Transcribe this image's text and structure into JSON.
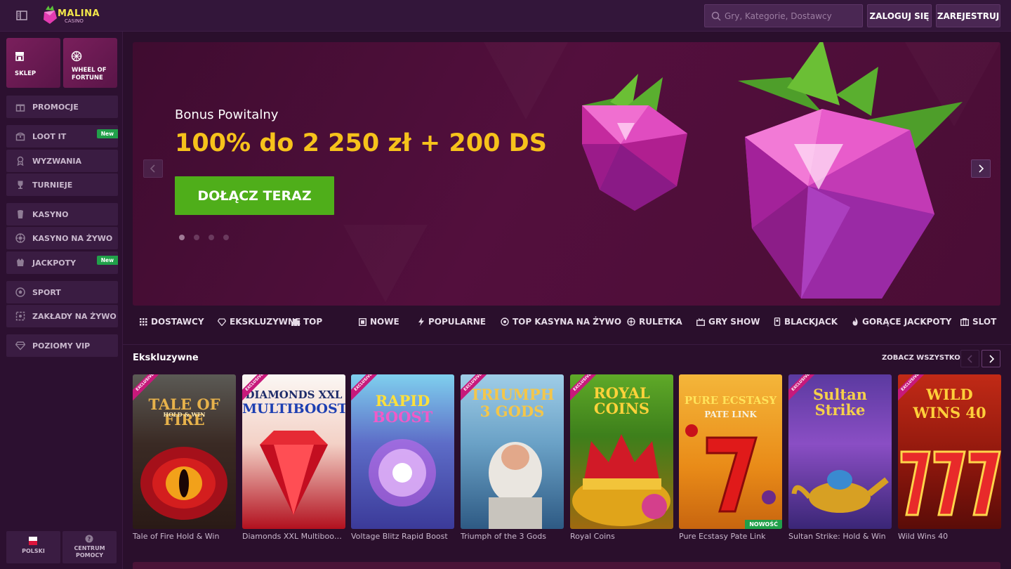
{
  "brand": {
    "name": "MALINA",
    "sub": "CASINO"
  },
  "header": {
    "search_placeholder": "Gry, Kategorie, Dostawcy",
    "login_label": "ZALOGUJ SIĘ",
    "register_label": "ZAREJESTRUJ"
  },
  "sidebar": {
    "tiles": [
      {
        "label": "SKLEP",
        "icon": "shop-icon"
      },
      {
        "label_line1": "WHEEL OF",
        "label_line2": "FORTUNE",
        "icon": "wheel-icon"
      }
    ],
    "items": [
      {
        "label": "PROMOCJE",
        "icon": "gift-icon"
      },
      {
        "label": "LOOT IT",
        "icon": "chest-icon",
        "badge": "New"
      },
      {
        "label": "WYZWANIA",
        "icon": "medal-icon"
      },
      {
        "label": "TURNIEJE",
        "icon": "trophy-icon"
      },
      {
        "label": "KASYNO",
        "icon": "slot-icon"
      },
      {
        "label": "KASYNO NA ŻYWO",
        "icon": "chip-icon"
      },
      {
        "label": "JACKPOTY",
        "icon": "jackpot-icon",
        "badge": "New"
      },
      {
        "label": "SPORT",
        "icon": "ball-icon"
      },
      {
        "label": "ZAKŁADY NA ŻYWO",
        "icon": "live-bet-icon"
      },
      {
        "label": "POZIOMY VIP",
        "icon": "diamond-icon"
      }
    ],
    "bottom": {
      "language": "POLSKI",
      "help_line1": "CENTRUM",
      "help_line2": "POMOCY"
    }
  },
  "hero": {
    "subtitle": "Bonus Powitalny",
    "title": "100% do 2 250 zł + 200 DS",
    "cta": "DOŁĄCZ TERAZ",
    "slides": 4,
    "active_slide": 1
  },
  "categories": [
    {
      "label": "DOSTAWCY",
      "icon": "grid-icon"
    },
    {
      "label": "EKSKLUZYWNE",
      "icon": "gem-icon"
    },
    {
      "label": "TOP",
      "icon": "podium-icon"
    },
    {
      "label": "NOWE",
      "icon": "new-icon"
    },
    {
      "label": "POPULARNE",
      "icon": "bolt-icon"
    },
    {
      "label": "TOP KASYNA NA ŻYWO",
      "icon": "live-icon"
    },
    {
      "label": "RULETKA",
      "icon": "roulette-icon"
    },
    {
      "label": "GRY SHOW",
      "icon": "show-icon"
    },
    {
      "label": "BLACKJACK",
      "icon": "cards-icon"
    },
    {
      "label": "GORĄCE JACKPOTY",
      "icon": "flame-icon"
    },
    {
      "label": "SLOT",
      "icon": "slot-machine-icon"
    }
  ],
  "exclusive": {
    "title": "Ekskluzywne",
    "see_all": "ZOBACZ WSZYSTKO",
    "ribbon": "EXCLUSIVE",
    "games": [
      {
        "name": "Tale of Fire Hold & Win",
        "art_line1": "TALE OF FIRE",
        "art_line2": "HOLD & WIN"
      },
      {
        "name": "Diamonds XXL Multiboost: ...",
        "art_line1": "DIAMONDS XXL",
        "art_line2": "MULTIBOOST"
      },
      {
        "name": "Voltage Blitz Rapid Boost",
        "art_line1": "RAPID",
        "art_line2": "BOOST"
      },
      {
        "name": "Triumph of the 3 Gods",
        "art_line1": "TRIUMPH",
        "art_line2": "3 GODS"
      },
      {
        "name": "Royal Coins",
        "art_line1": "ROYAL",
        "art_line2": "COINS"
      },
      {
        "name": "Pure Ecstasy Pate Link",
        "art_line1": "PURE ECSTASY",
        "art_line2": "PATE LINK",
        "badge": "NOWOŚĆ"
      },
      {
        "name": "Sultan Strike: Hold & Win",
        "art_line1": "Sultan",
        "art_line2": "Strike"
      },
      {
        "name": "Wild Wins 40",
        "art_line1": "WILD",
        "art_line2": "WINS 40"
      }
    ]
  }
}
